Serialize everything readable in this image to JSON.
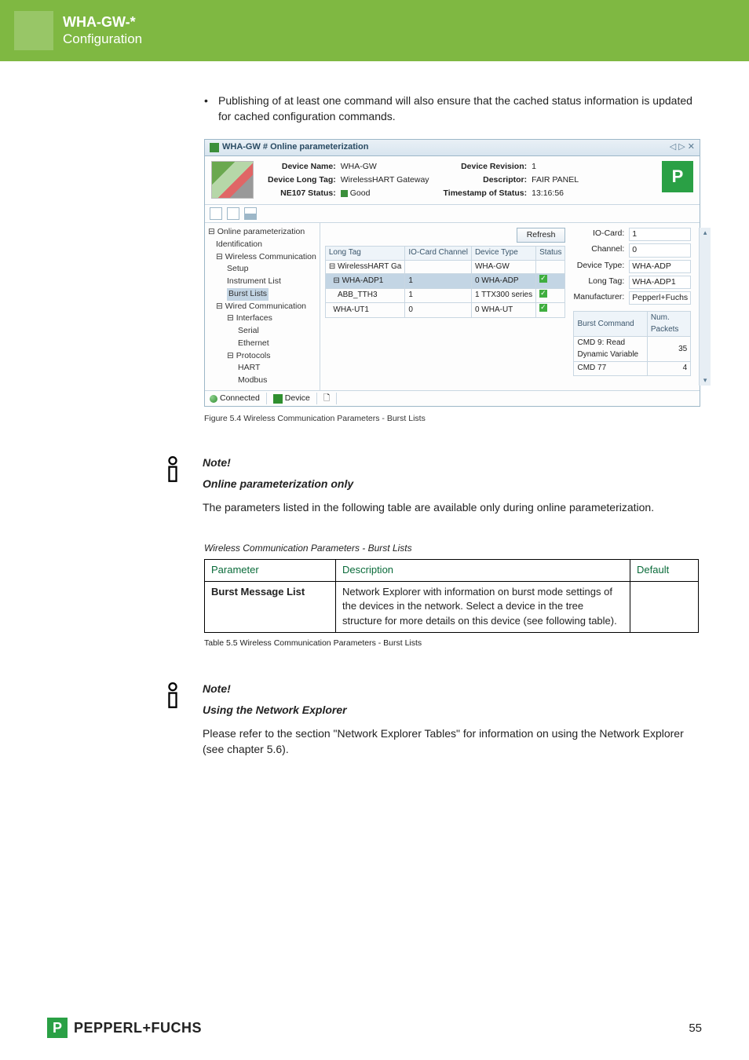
{
  "topbar": {
    "doc_id": "WHA-GW-*",
    "section": "Configuration"
  },
  "bullet": "Publishing of at least one command will also ensure that the cached status information is updated for cached configuration commands.",
  "screenshot": {
    "tab_title": "WHA-GW # Online parameterization",
    "header": {
      "device_name_lbl": "Device Name:",
      "device_name_val": "WHA-GW",
      "device_long_tag_lbl": "Device Long Tag:",
      "device_long_tag_val": "WirelessHART Gateway",
      "ne107_lbl": "NE107 Status:",
      "ne107_val": "Good",
      "device_revision_lbl": "Device Revision:",
      "device_revision_val": "1",
      "descriptor_lbl": "Descriptor:",
      "descriptor_val": "FAIR PANEL",
      "timestamp_lbl": "Timestamp of Status:",
      "timestamp_val": "13:16:56"
    },
    "tree": {
      "n0": "Online parameterization",
      "n1": "Identification",
      "n2": "Wireless Communication",
      "n2a": "Setup",
      "n2b": "Instrument List",
      "n2c": "Burst Lists",
      "n3": "Wired Communication",
      "n3a": "Interfaces",
      "n3a1": "Serial",
      "n3a2": "Ethernet",
      "n3b": "Protocols",
      "n3b1": "HART",
      "n3b2": "Modbus"
    },
    "grid": {
      "h_longtag": "Long Tag",
      "h_io": "IO-Card Channel",
      "h_devtype": "Device Type",
      "h_status": "Status",
      "r0_lt": "WirelessHART Ga",
      "r0_io": "",
      "r0_dt": "WHA-GW",
      "r0_st": "",
      "r1_lt": "WHA-ADP1",
      "r1_io": "1",
      "r1_dt": "0  WHA-ADP",
      "r2_lt": "ABB_TTH3",
      "r2_io": "1",
      "r2_dt": "1  TTX300 series",
      "r3_lt": "WHA-UT1",
      "r3_io": "0",
      "r3_dt": "0  WHA-UT"
    },
    "refresh_btn": "Refresh",
    "right": {
      "iocard_lbl": "IO-Card:",
      "iocard_val": "1",
      "channel_lbl": "Channel:",
      "channel_val": "0",
      "devtype_lbl": "Device Type:",
      "devtype_val": "WHA-ADP",
      "longtag_lbl": "Long Tag:",
      "longtag_val": "WHA-ADP1",
      "manuf_lbl": "Manufacturer:",
      "manuf_val": "Pepperl+Fuchs",
      "burst_h1": "Burst Command",
      "burst_h2": "Num. Packets",
      "br1_c": "CMD 9: Read Dynamic Variable",
      "br1_n": "35",
      "br2_c": "CMD 77",
      "br2_n": "4"
    },
    "status": {
      "connected": "Connected",
      "device": "Device"
    }
  },
  "fig_caption": "Figure 5.4 Wireless Communication Parameters - Burst Lists",
  "note1": {
    "hd": "Note!",
    "sub": "Online parameterization only",
    "body": "The parameters listed in the following table are available only during online parameterization."
  },
  "tbl_caption": "Wireless Communication Parameters - Burst Lists",
  "params_table": {
    "h_param": "Parameter",
    "h_desc": "Description",
    "h_default": "Default",
    "r1_param": "Burst Message List",
    "r1_desc": "Network Explorer with information on burst mode settings of the devices in the network. Select a device in the tree structure for more details on this device (see following table)."
  },
  "table_caption_2": "Table 5.5 Wireless Communication Parameters - Burst Lists",
  "note2": {
    "hd": "Note!",
    "sub": "Using the Network Explorer",
    "body": "Please refer to the section \"Network Explorer Tables\" for information on using the Network Explorer (see chapter 5.6)."
  },
  "footer": {
    "brand": "PEPPERL+FUCHS",
    "page": "55",
    "logo_glyph": "P"
  }
}
